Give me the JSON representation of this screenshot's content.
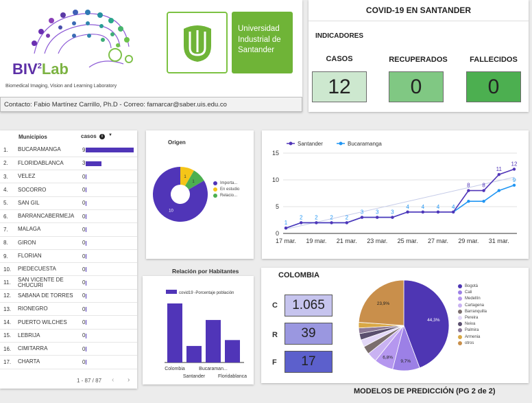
{
  "header": {
    "lab_logo_text": "BIV",
    "lab_logo_sup": "2",
    "lab_logo_suffix": "Lab",
    "lab_name": "Biomedical Imaging, Vision and Learning Laboratory",
    "uis_name": "Universidad Industrial de Santander",
    "contact": "Contacto: Fabio Martínez Carrillo, Ph.D - Correo: famarcar@saber.uis.edu.co",
    "title": "COVID-19 EN SANTANDER",
    "indicators_title": "INDICADORES"
  },
  "kpis": [
    {
      "label": "CASOS",
      "value": "12",
      "color": "#cde8cf"
    },
    {
      "label": "RECUPERADOS",
      "value": "0",
      "color": "#80c883"
    },
    {
      "label": "FALLECIDOS",
      "value": "0",
      "color": "#4caf50"
    }
  ],
  "municipios": {
    "col_name": "Municipios",
    "col_cases": "casos",
    "pagination": "1 - 87 / 87",
    "max": 9,
    "rows": [
      {
        "n": "1.",
        "name": "BUCARAMANGA",
        "cases": 9
      },
      {
        "n": "2.",
        "name": "FLORIDABLANCA",
        "cases": 3
      },
      {
        "n": "3.",
        "name": "VELEZ",
        "cases": 0
      },
      {
        "n": "4.",
        "name": "SOCORRO",
        "cases": 0
      },
      {
        "n": "5.",
        "name": "SAN GIL",
        "cases": 0
      },
      {
        "n": "6.",
        "name": "BARRANCABERMEJA",
        "cases": 0
      },
      {
        "n": "7.",
        "name": "MALAGA",
        "cases": 0
      },
      {
        "n": "8.",
        "name": "GIRON",
        "cases": 0
      },
      {
        "n": "9.",
        "name": "FLORIAN",
        "cases": 0
      },
      {
        "n": "10.",
        "name": "PIEDECUESTA",
        "cases": 0
      },
      {
        "n": "11.",
        "name": "SAN VICENTE DE CHUCURI",
        "cases": 0
      },
      {
        "n": "12.",
        "name": "SABANA DE TORRES",
        "cases": 0
      },
      {
        "n": "13.",
        "name": "RIONEGRO",
        "cases": 0
      },
      {
        "n": "14.",
        "name": "PUERTO WILCHES",
        "cases": 0
      },
      {
        "n": "15.",
        "name": "LEBRIJA",
        "cases": 0
      },
      {
        "n": "16.",
        "name": "CIMITARRA",
        "cases": 0
      },
      {
        "n": "17.",
        "name": "CHARTA",
        "cases": 0
      }
    ]
  },
  "origen": {
    "title": "Origen",
    "chart_data": {
      "type": "pie",
      "labels": [
        "Importa...",
        "En estudio",
        "Relacio..."
      ],
      "values": [
        10,
        1,
        1
      ],
      "colors": [
        "#5035b8",
        "#f5c518",
        "#4caf50"
      ]
    }
  },
  "timeline": {
    "chart_data": {
      "type": "line",
      "x": [
        "17 mar.",
        "18 mar.",
        "19 mar.",
        "20 mar.",
        "21 mar.",
        "22 mar.",
        "23 mar.",
        "24 mar.",
        "25 mar.",
        "26 mar.",
        "27 mar.",
        "28 mar.",
        "29 mar.",
        "30 mar.",
        "31 mar.",
        "1 abr."
      ],
      "xticks": [
        "17 mar.",
        "19 mar.",
        "21 mar.",
        "23 mar.",
        "25 mar.",
        "27 mar.",
        "29 mar.",
        "31 mar."
      ],
      "series": [
        {
          "name": "Santander",
          "color": "#5035b8",
          "values": [
            1,
            2,
            2,
            2,
            2,
            3,
            3,
            3,
            4,
            4,
            4,
            4,
            8,
            8,
            11,
            12
          ]
        },
        {
          "name": "Bucaramanga",
          "color": "#2196f3",
          "values": [
            1,
            2,
            2,
            2,
            2,
            3,
            3,
            3,
            4,
            4,
            4,
            4,
            6,
            6,
            8,
            9
          ]
        }
      ],
      "labels_santander": [
        "",
        "",
        "",
        "",
        "",
        "",
        "",
        "",
        "",
        "",
        "",
        "",
        "8",
        "8",
        "11",
        "12"
      ],
      "labels_bucaramanga": [
        "1",
        "2",
        "2",
        "2",
        "2",
        "3",
        "3",
        "3",
        "4",
        "4",
        "4",
        "4",
        "",
        "",
        "",
        "9"
      ],
      "ylim": [
        0,
        15
      ],
      "yticks": [
        "0",
        "5",
        "10",
        "15"
      ]
    }
  },
  "relacion": {
    "title": "Relación por Habitantes",
    "chart_data": {
      "type": "bar",
      "series_name": "covid19 -Porcentaje población",
      "categories": [
        "Colombia",
        "Santander",
        "Bucaraman...",
        "Floridablanca"
      ],
      "values": [
        1.0,
        0.28,
        0.72,
        0.38
      ],
      "color": "#5035b8"
    }
  },
  "colombia": {
    "title": "COLOMBIA",
    "indicators": [
      {
        "label": "C",
        "value": "1.065",
        "color": "#c6c4ee"
      },
      {
        "label": "R",
        "value": "39",
        "color": "#9a97e0"
      },
      {
        "label": "F",
        "value": "17",
        "color": "#5c60cc"
      }
    ],
    "chart_data": {
      "type": "pie",
      "labels": [
        "Bogotá",
        "Cali",
        "Medellín",
        "Cartagena",
        "Barranquilla",
        "Pereira",
        "Neiva",
        "Palmira",
        "Armenia",
        "otros"
      ],
      "values": [
        44.3,
        9.7,
        6.8,
        3.5,
        2.9,
        2.6,
        2.3,
        2.0,
        2.0,
        23.9
      ],
      "slice_labels": [
        "44,3%",
        "9,7%",
        "6,8%",
        "",
        "",
        "",
        "",
        "",
        "",
        "23,9%"
      ],
      "colors": [
        "#4e36b3",
        "#9c80e6",
        "#b597ef",
        "#c9b2f2",
        "#7b6e6e",
        "#e2d7f7",
        "#5a4f6e",
        "#8d7a98",
        "#d9a845",
        "#c98f4b"
      ]
    }
  },
  "footer": "MODELOS DE PREDICCIÓN (PG 2 de 2)"
}
